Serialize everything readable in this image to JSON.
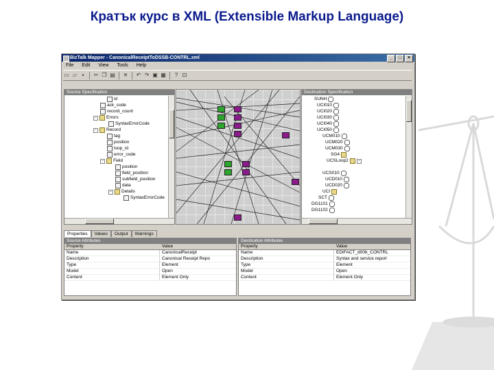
{
  "slide": {
    "title": "Кратък курс в XML (Extensible Markup Language)"
  },
  "window": {
    "title": "BizTalk Mapper - CanonicalReceiptToDSSB-CONTRL.xml",
    "menu": [
      "File",
      "Edit",
      "View",
      "Tools",
      "Help"
    ]
  },
  "source_pane": {
    "header": "Source Specification",
    "items": [
      "id",
      "ack_code",
      "record_count",
      "Errors",
      "SyntaxErrorCode",
      "Record",
      "tag",
      "position",
      "loop_id",
      "error_code",
      "Field",
      "position",
      "field_position",
      "subfield_position",
      "data",
      "Details",
      "SyntaxErrorCode"
    ]
  },
  "dest_pane": {
    "header": "Destination Specification",
    "items": [
      "SUNH",
      "UCI010",
      "UCI020",
      "UCI030",
      "UCI040",
      "UCI050",
      "UCM010",
      "UCM020",
      "UCM030",
      "SG4",
      "UCSLoop2",
      "UCS010",
      "UCD010",
      "UCD020",
      "UCI",
      "SCT",
      "DG1101",
      "DG1102"
    ]
  },
  "tabs": [
    "Properties",
    "Values",
    "Output",
    "Warnings"
  ],
  "source_props": {
    "header": "Source Attributes",
    "columns": [
      "Property",
      "Value"
    ],
    "rows": [
      [
        "Name",
        "CanonicalReceipt"
      ],
      [
        "Description",
        "Canonical Receipt Repo"
      ],
      [
        "Type",
        "Element"
      ],
      [
        "Model",
        "Open"
      ],
      [
        "Content",
        "Element Only"
      ]
    ]
  },
  "dest_props": {
    "header": "Destination Attributes",
    "columns": [
      "Property",
      "Value"
    ],
    "rows": [
      [
        "Name",
        "EDIFACT_d00b_CONTRL"
      ],
      [
        "Description",
        "Syntax and service report"
      ],
      [
        "Type",
        "Element"
      ],
      [
        "Model",
        "Open"
      ],
      [
        "Content",
        "Element Only"
      ]
    ]
  }
}
